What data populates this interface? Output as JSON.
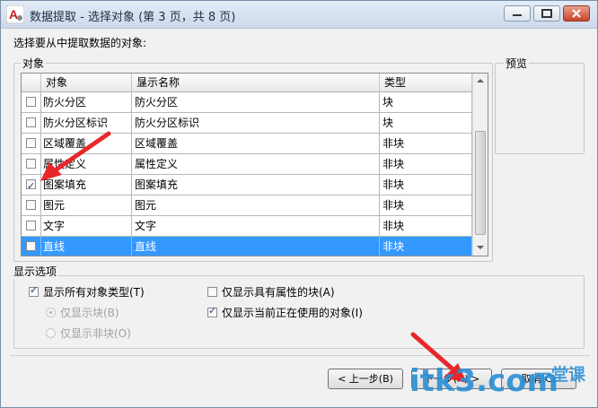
{
  "window": {
    "title": "数据提取 - 选择对象 (第 3 页，共 8 页)"
  },
  "prompt": "选择要从中提取数据的对象:",
  "objects_group": {
    "label": "对象",
    "columns": [
      "对象",
      "显示名称",
      "类型"
    ],
    "rows": [
      {
        "object": "防火分区",
        "display": "防火分区",
        "type": "块",
        "checked": false,
        "selected": false
      },
      {
        "object": "防火分区标识",
        "display": "防火分区标识",
        "type": "块",
        "checked": false,
        "selected": false
      },
      {
        "object": "区域覆盖",
        "display": "区域覆盖",
        "type": "非块",
        "checked": false,
        "selected": false
      },
      {
        "object": "属性定义",
        "display": "属性定义",
        "type": "非块",
        "checked": false,
        "selected": false
      },
      {
        "object": "图案填充",
        "display": "图案填充",
        "type": "非块",
        "checked": true,
        "selected": false
      },
      {
        "object": "图元",
        "display": "图元",
        "type": "非块",
        "checked": false,
        "selected": false
      },
      {
        "object": "文字",
        "display": "文字",
        "type": "非块",
        "checked": false,
        "selected": false
      },
      {
        "object": "直线",
        "display": "直线",
        "type": "非块",
        "checked": false,
        "selected": true
      }
    ]
  },
  "preview": {
    "label": "预览"
  },
  "display_options": {
    "label": "显示选项",
    "show_all_types": {
      "label": "显示所有对象类型(T)",
      "checked": true
    },
    "blocks_only": {
      "label": "仅显示块(B)",
      "selected": true,
      "enabled": false
    },
    "non_blocks_only": {
      "label": "仅显示非块(O)",
      "selected": false,
      "enabled": false
    },
    "blocks_with_attributes": {
      "label": "仅显示具有属性的块(A)",
      "checked": false
    },
    "in_use_only": {
      "label": "仅显示当前正在使用的对象(I)",
      "checked": true
    }
  },
  "buttons": {
    "back": "< 上一步(B)",
    "next": "下一步(N) >",
    "cancel": "取消(C)"
  },
  "watermark": {
    "site": "itk3.com",
    "label": "一堂课"
  },
  "colors": {
    "selection": "#3399ff",
    "annotation_arrow": "#e8272a",
    "watermark": "#2a8fd6"
  }
}
